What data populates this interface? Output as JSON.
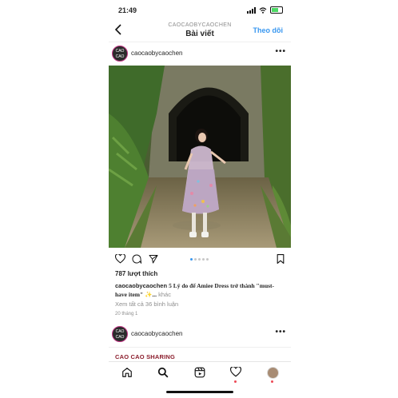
{
  "status": {
    "time": "21:49"
  },
  "header": {
    "username": "CAOCAOBYCAOCHEN",
    "title": "Bài viết",
    "follow": "Theo dõi"
  },
  "post": {
    "username": "caocaobycaochen",
    "avatar_text": "CAO CAO",
    "likes": "787 lượt thích",
    "caption_user": "caocaobycaochen",
    "caption_text": "5 Lý do để Amiee Dress trở thành \"must-have item\" ✨...",
    "caption_more": "khác",
    "comments": "Xem tất cả 36 bình luận",
    "date": "20 tháng 1"
  },
  "next_post": {
    "username": "caocaobycaochen",
    "avatar_text": "CAO CAO",
    "caption": "CAO CAO SHARING"
  },
  "icons": {
    "back": "chevron-left-icon",
    "more": "more-horizontal-icon",
    "like": "heart-icon",
    "comment": "comment-icon",
    "share": "send-icon",
    "save": "bookmark-icon",
    "home": "home-icon",
    "search": "search-icon",
    "reels": "reels-icon",
    "activity": "heart-icon",
    "profile": "profile-avatar"
  },
  "colors": {
    "link": "#3897f0",
    "accent": "#8b1d2c",
    "notify": "#ed4956"
  }
}
